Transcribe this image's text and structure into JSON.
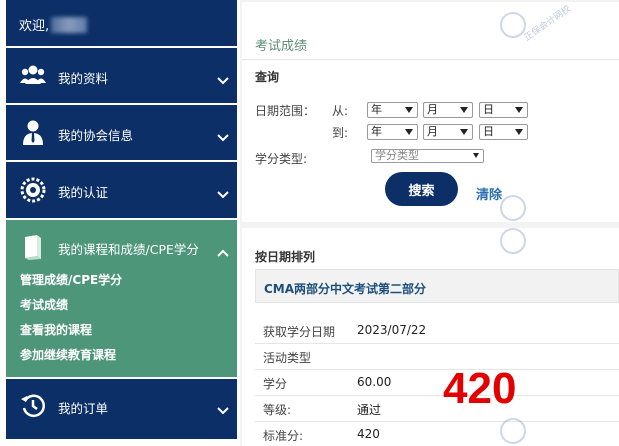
{
  "sidebar": {
    "welcome": "欢迎,",
    "items": [
      {
        "label": "我的资料",
        "icon": "users-icon"
      },
      {
        "label": "我的协会信息",
        "icon": "person-icon"
      },
      {
        "label": "我的认证",
        "icon": "gear-badge-icon"
      },
      {
        "label": "我的课程和成绩/CPE学分",
        "icon": "book-icon"
      },
      {
        "label": "我的订单",
        "icon": "history-icon"
      }
    ],
    "subitems": [
      "管理成绩/CPE学分",
      "考试成绩",
      "查看我的课程",
      "参加继续教育课程"
    ]
  },
  "main": {
    "title": "考试成绩",
    "query_label": "查询",
    "date_range_label": "日期范围：",
    "from_label": "从:",
    "to_label": "到:",
    "year": "年",
    "month": "月",
    "day": "日",
    "credit_type_label": "学分类型:",
    "credit_type_select": "学分类型",
    "search_button": "搜索",
    "clear_link": "清除",
    "sort_label": "按日期排列",
    "course_title": "CMA两部分中文考试第二部分",
    "rows": [
      {
        "label": "获取学分日期",
        "value": "2023/07/22"
      },
      {
        "label": "活动类型",
        "value": ""
      },
      {
        "label": "学分",
        "value": "60.00"
      },
      {
        "label": "等级:",
        "value": "通过"
      },
      {
        "label": "标准分:",
        "value": "420"
      }
    ],
    "score_overlay": "420",
    "watermark": "正保会计网校"
  },
  "colors": {
    "navy": "#0b2f66",
    "green": "#4e967a",
    "red": "#e20000",
    "title": "#5e8e72"
  }
}
